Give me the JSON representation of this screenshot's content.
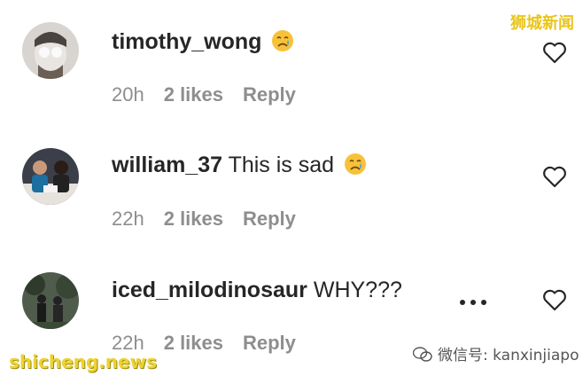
{
  "watermark_top": "狮城新闻",
  "watermark_left": "shicheng.news",
  "watermark_right": "微信号: kanxinjiapo",
  "comments": [
    {
      "username": "timothy_wong",
      "text": "",
      "emoji": "crying-face",
      "time": "20h",
      "likes": "2 likes",
      "reply": "Reply"
    },
    {
      "username": "william_37",
      "text": "This is sad",
      "emoji": "crying-face",
      "time": "22h",
      "likes": "2 likes",
      "reply": "Reply"
    },
    {
      "username": "iced_milodinosaur",
      "text": "WHY???",
      "emoji": "",
      "time": "22h",
      "likes": "2 likes",
      "reply": "Reply"
    }
  ]
}
